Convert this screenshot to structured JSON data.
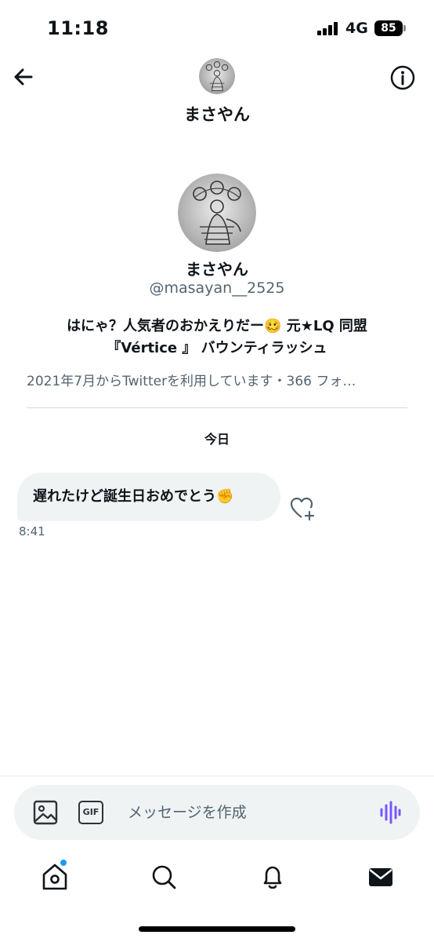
{
  "status_bar": {
    "time": "11:18",
    "network": "4G",
    "battery": "85"
  },
  "header": {
    "name": "まさやん",
    "back_icon": "back-arrow-icon",
    "info_icon": "info-icon"
  },
  "profile": {
    "name": "まさやん",
    "handle": "@masayan__2525",
    "bio_line1": "はにゃ？人気者のおかえりだー🥴 元★LQ 同盟",
    "bio_line2": "『Vértice 』 バウンティラッシュ",
    "meta": "2021年7月からTwitterを利用しています・366 フォ…"
  },
  "conversation": {
    "date_label": "今日",
    "messages": [
      {
        "text": "遅れたけど誕生日おめでとう✊",
        "time": "8:41"
      }
    ]
  },
  "composer": {
    "placeholder": "メッセージを作成",
    "gif_label": "GIF"
  },
  "tab_bar": {
    "items": [
      "home-icon",
      "search-icon",
      "notifications-icon",
      "messages-icon"
    ]
  },
  "colors": {
    "accent": "#1d9bf0",
    "secondary_text": "#536471",
    "voice": "#7856ff"
  }
}
